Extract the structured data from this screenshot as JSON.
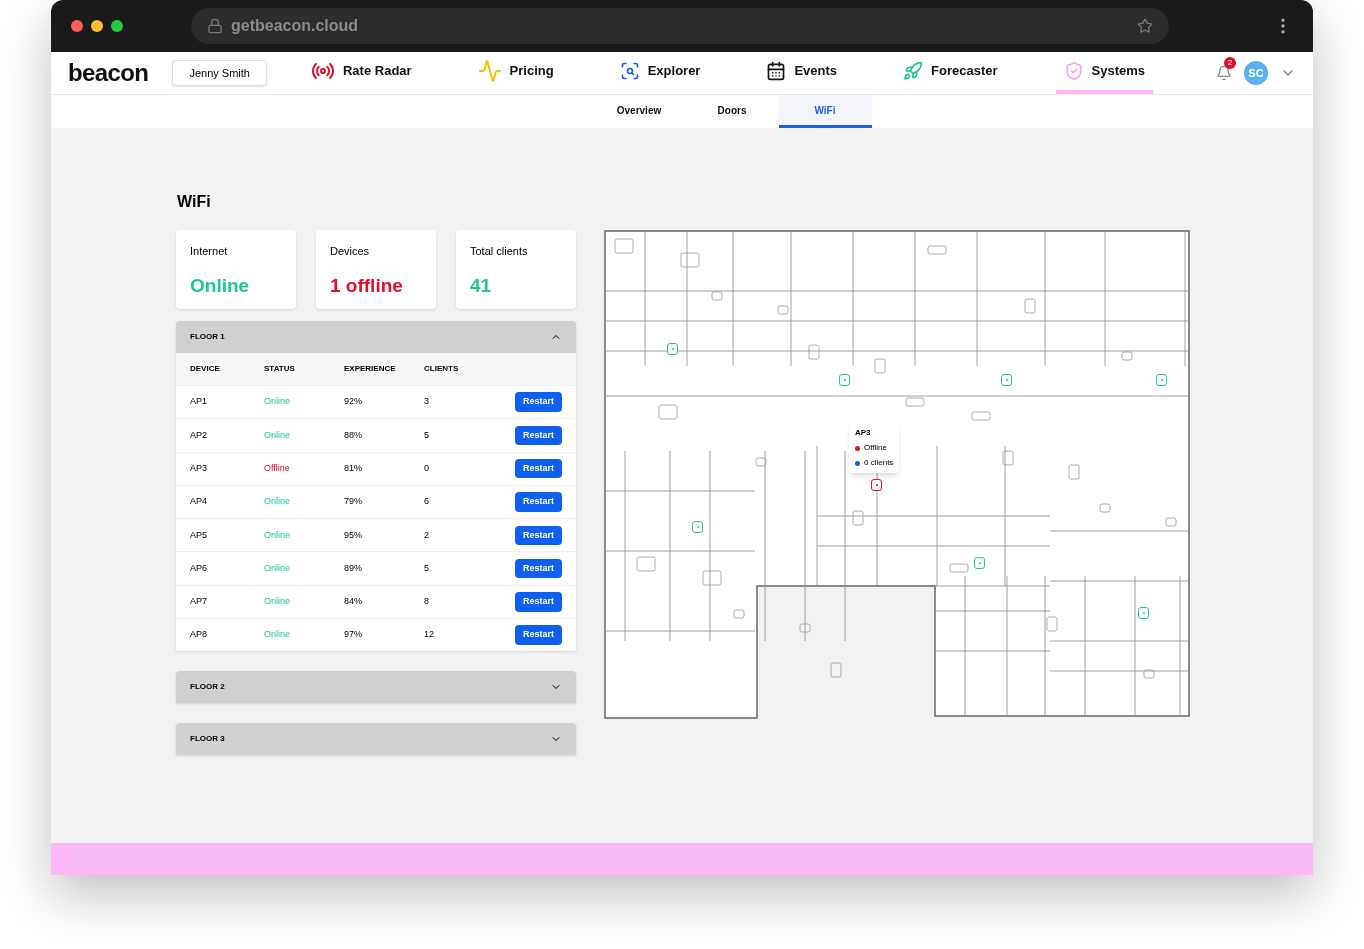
{
  "browser": {
    "url": "getbeacon.cloud"
  },
  "header": {
    "logo": "beacon",
    "user": "Jenny Smith",
    "nav": [
      {
        "label": "Rate Radar",
        "selected": false
      },
      {
        "label": "Pricing",
        "selected": false
      },
      {
        "label": "Explorer",
        "selected": false
      },
      {
        "label": "Events",
        "selected": false
      },
      {
        "label": "Forecaster",
        "selected": false
      },
      {
        "label": "Systems",
        "selected": true
      }
    ],
    "notifications": "2",
    "avatar": "SC"
  },
  "subtabs": [
    {
      "label": "Overview",
      "selected": false
    },
    {
      "label": "Doors",
      "selected": false
    },
    {
      "label": "WiFi",
      "selected": true
    }
  ],
  "page_title": "WiFi",
  "stats": [
    {
      "label": "Internet",
      "value": "Online",
      "good": true
    },
    {
      "label": "Devices",
      "value": "1 offline",
      "good": false
    },
    {
      "label": "Total clients",
      "value": "41",
      "good": true
    }
  ],
  "floors": [
    {
      "title": "FLOOR 1",
      "expanded": true,
      "columns": [
        "DEVICE",
        "STATUS",
        "EXPERIENCE",
        "CLIENTS"
      ],
      "devices": [
        {
          "name": "AP1",
          "status": "Online",
          "online": true,
          "experience": "92%",
          "clients": "3",
          "action": "Restart"
        },
        {
          "name": "AP2",
          "status": "Online",
          "online": true,
          "experience": "88%",
          "clients": "5",
          "action": "Restart"
        },
        {
          "name": "AP3",
          "status": "Offline",
          "online": false,
          "experience": "81%",
          "clients": "0",
          "action": "Restart"
        },
        {
          "name": "AP4",
          "status": "Online",
          "online": true,
          "experience": "79%",
          "clients": "6",
          "action": "Restart"
        },
        {
          "name": "AP5",
          "status": "Online",
          "online": true,
          "experience": "95%",
          "clients": "2",
          "action": "Restart"
        },
        {
          "name": "AP6",
          "status": "Online",
          "online": true,
          "experience": "89%",
          "clients": "5",
          "action": "Restart"
        },
        {
          "name": "AP7",
          "status": "Online",
          "online": true,
          "experience": "84%",
          "clients": "8",
          "action": "Restart"
        },
        {
          "name": "AP8",
          "status": "Online",
          "online": true,
          "experience": "97%",
          "clients": "12",
          "action": "Restart"
        }
      ]
    },
    {
      "title": "FLOOR 2",
      "expanded": false
    },
    {
      "title": "FLOOR 3",
      "expanded": false
    }
  ],
  "map_tooltip": {
    "device": "AP3",
    "status": "Offline",
    "clients": "0 clients"
  }
}
